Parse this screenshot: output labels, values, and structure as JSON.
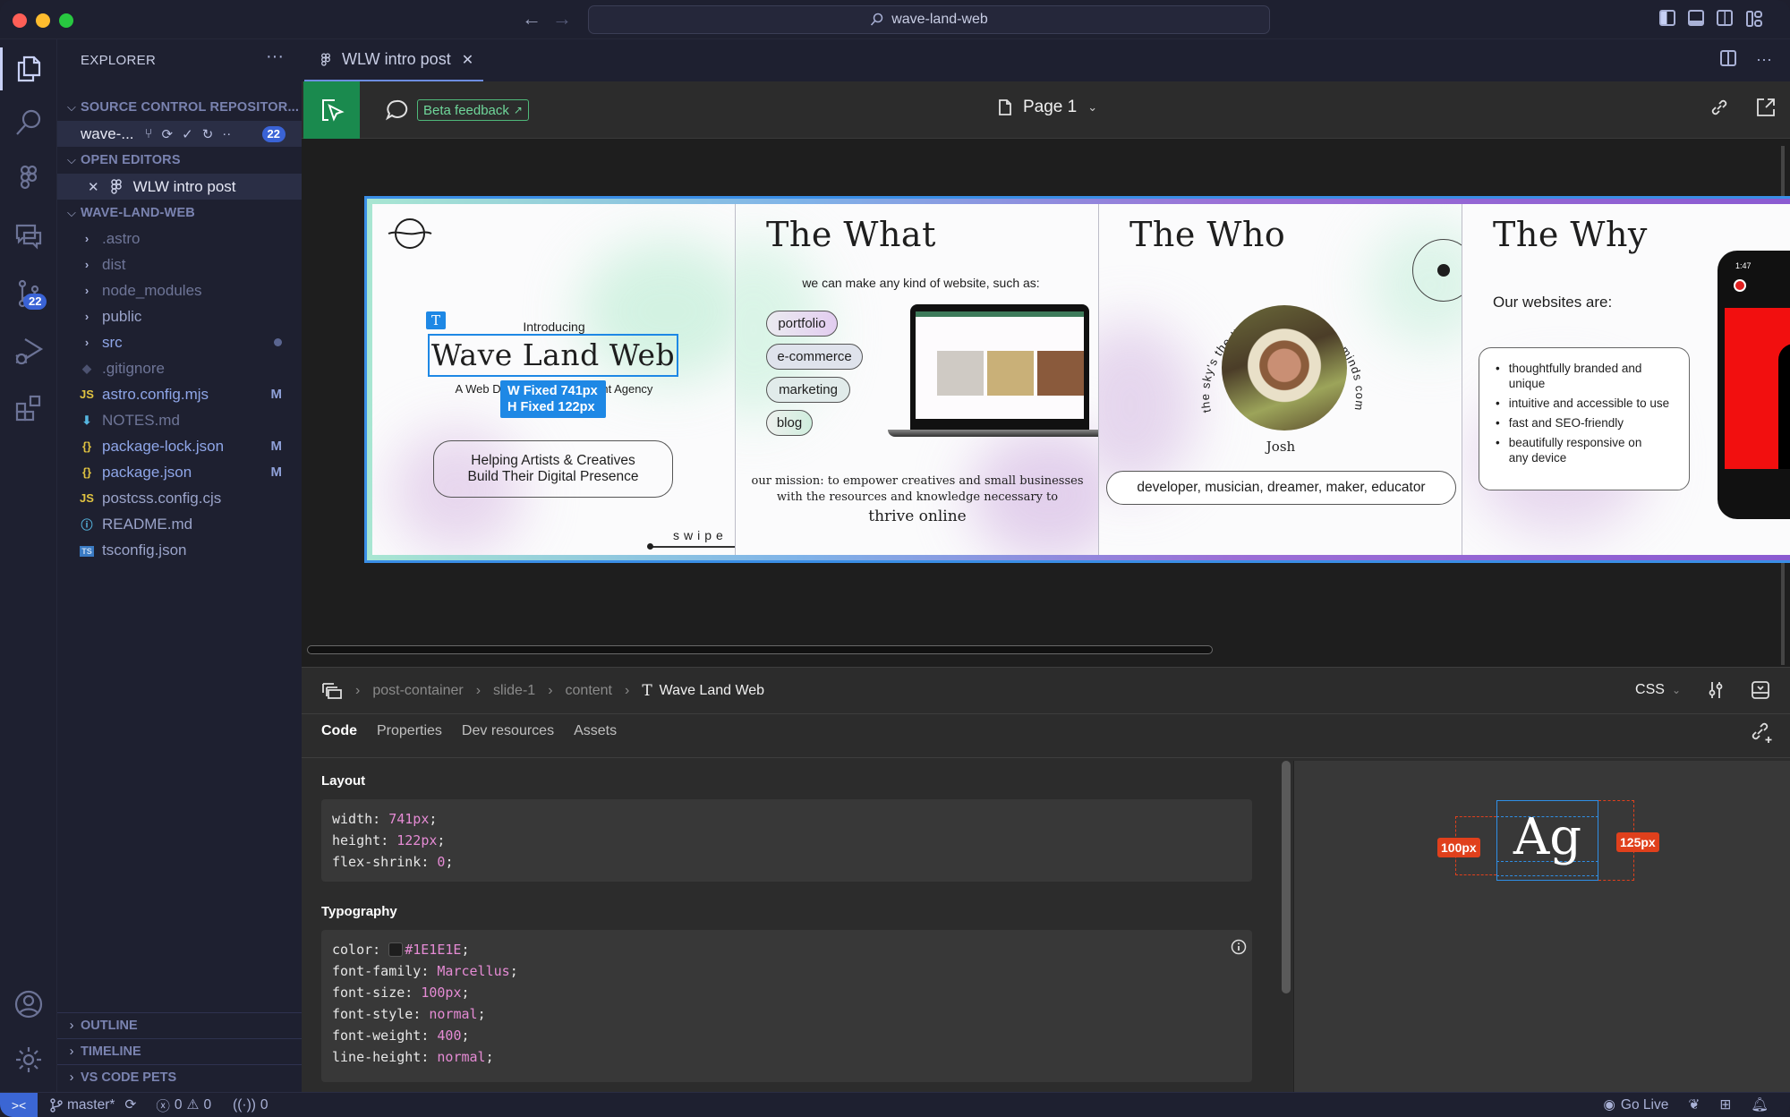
{
  "window": {
    "command_center": "wave-land-web",
    "nav_back": "←",
    "nav_forward": "→"
  },
  "activity_bar": {
    "items": [
      {
        "name": "explorer",
        "active": true
      },
      {
        "name": "search"
      },
      {
        "name": "figma"
      },
      {
        "name": "comments"
      },
      {
        "name": "source-control",
        "badge": "22"
      },
      {
        "name": "run-debug"
      },
      {
        "name": "extensions"
      }
    ],
    "bottom": [
      {
        "name": "accounts"
      },
      {
        "name": "manage"
      }
    ]
  },
  "sidebar": {
    "title": "EXPLORER",
    "more": "···",
    "source_control": {
      "header": "SOURCE CONTROL REPOSITOR...",
      "repo": "wave-...",
      "badge": "22"
    },
    "open_editors": {
      "header": "OPEN EDITORS",
      "items": [
        {
          "label": "WLW intro post"
        }
      ]
    },
    "project": {
      "header": "WAVE-LAND-WEB",
      "folders": [
        ".astro",
        "dist",
        "node_modules",
        "public",
        "src"
      ],
      "files": [
        {
          "icon": "git",
          "label": ".gitignore",
          "mark": ""
        },
        {
          "icon": "JS",
          "label": "astro.config.mjs",
          "mark": "M"
        },
        {
          "icon": "md",
          "label": "NOTES.md",
          "mark": ""
        },
        {
          "icon": "{}",
          "label": "package-lock.json",
          "mark": "M"
        },
        {
          "icon": "{}",
          "label": "package.json",
          "mark": "M"
        },
        {
          "icon": "JS",
          "label": "postcss.config.cjs",
          "mark": ""
        },
        {
          "icon": "info",
          "label": "README.md",
          "mark": ""
        },
        {
          "icon": "TS",
          "label": "tsconfig.json",
          "mark": ""
        }
      ]
    },
    "footer_sections": [
      "OUTLINE",
      "TIMELINE",
      "VS CODE PETS"
    ]
  },
  "editor": {
    "tab": {
      "label": "WLW intro post",
      "close": "✕"
    },
    "toolbar": {
      "beta_feedback": "Beta feedback",
      "page": "Page 1"
    }
  },
  "canvas": {
    "selection": {
      "w_label": "W  Fixed  741px",
      "h_label": "H  Fixed  122px"
    },
    "slides": [
      {
        "introducing": "Introducing",
        "title": "Wave Land Web",
        "subtitle": "A Web Design & Development Agency",
        "tagline_1": "Helping Artists & Creatives",
        "tagline_2": "Build Their Digital Presence",
        "swipe": "swipe"
      },
      {
        "title": "The What",
        "intro": "we can make any kind of website, such as:",
        "tags": [
          "portfolio",
          "e-commerce",
          "marketing",
          "blog"
        ],
        "mission_1": "our mission: to empower creatives and small businesses",
        "mission_2": "with the resources and knowledge necessary to",
        "mission_3": "thrive online"
      },
      {
        "title": "The Who",
        "circle_text": "the sky's the limit when creative minds come together",
        "name": "Josh",
        "roles": "developer, musician, dreamer, maker, educator"
      },
      {
        "title": "The Why",
        "intro": "Our websites are:",
        "bullets": [
          "thoughtfully branded and unique",
          "intuitive and accessible to use",
          "fast and SEO-friendly",
          "beautifully responsive on any device"
        ],
        "phone_time": "1:47"
      }
    ]
  },
  "inspector": {
    "breadcrumb": [
      "post-container",
      "slide-1",
      "content",
      "Wave Land Web"
    ],
    "language": "CSS",
    "tabs": [
      "Code",
      "Properties",
      "Dev resources",
      "Assets"
    ],
    "active_tab": "Code",
    "layout": {
      "heading": "Layout",
      "lines": [
        {
          "prop": "width",
          "value": "741px"
        },
        {
          "prop": "height",
          "value": "122px"
        },
        {
          "prop": "flex-shrink",
          "value": "0"
        }
      ]
    },
    "typography": {
      "heading": "Typography",
      "lines": [
        {
          "prop": "color",
          "value": "#1E1E1E"
        },
        {
          "prop": "font-family",
          "value": "Marcellus"
        },
        {
          "prop": "font-size",
          "value": "100px"
        },
        {
          "prop": "font-style",
          "value": "normal"
        },
        {
          "prop": "font-weight",
          "value": "400"
        },
        {
          "prop": "line-height",
          "value": "normal"
        }
      ]
    },
    "preview": {
      "glyph": "Ag",
      "font_size_label": "100px",
      "line_height_label": "125px"
    }
  },
  "status_bar": {
    "branch": "master*",
    "errors": "0",
    "warnings": "0",
    "ports": "0",
    "go_live": "Go Live"
  },
  "colors": {
    "accent_green": "#1a8a4e",
    "selection_blue": "#1e88e5",
    "badge_blue": "#3a63d6",
    "measure_red": "#e0401c",
    "code_value": "#e58bd4"
  }
}
